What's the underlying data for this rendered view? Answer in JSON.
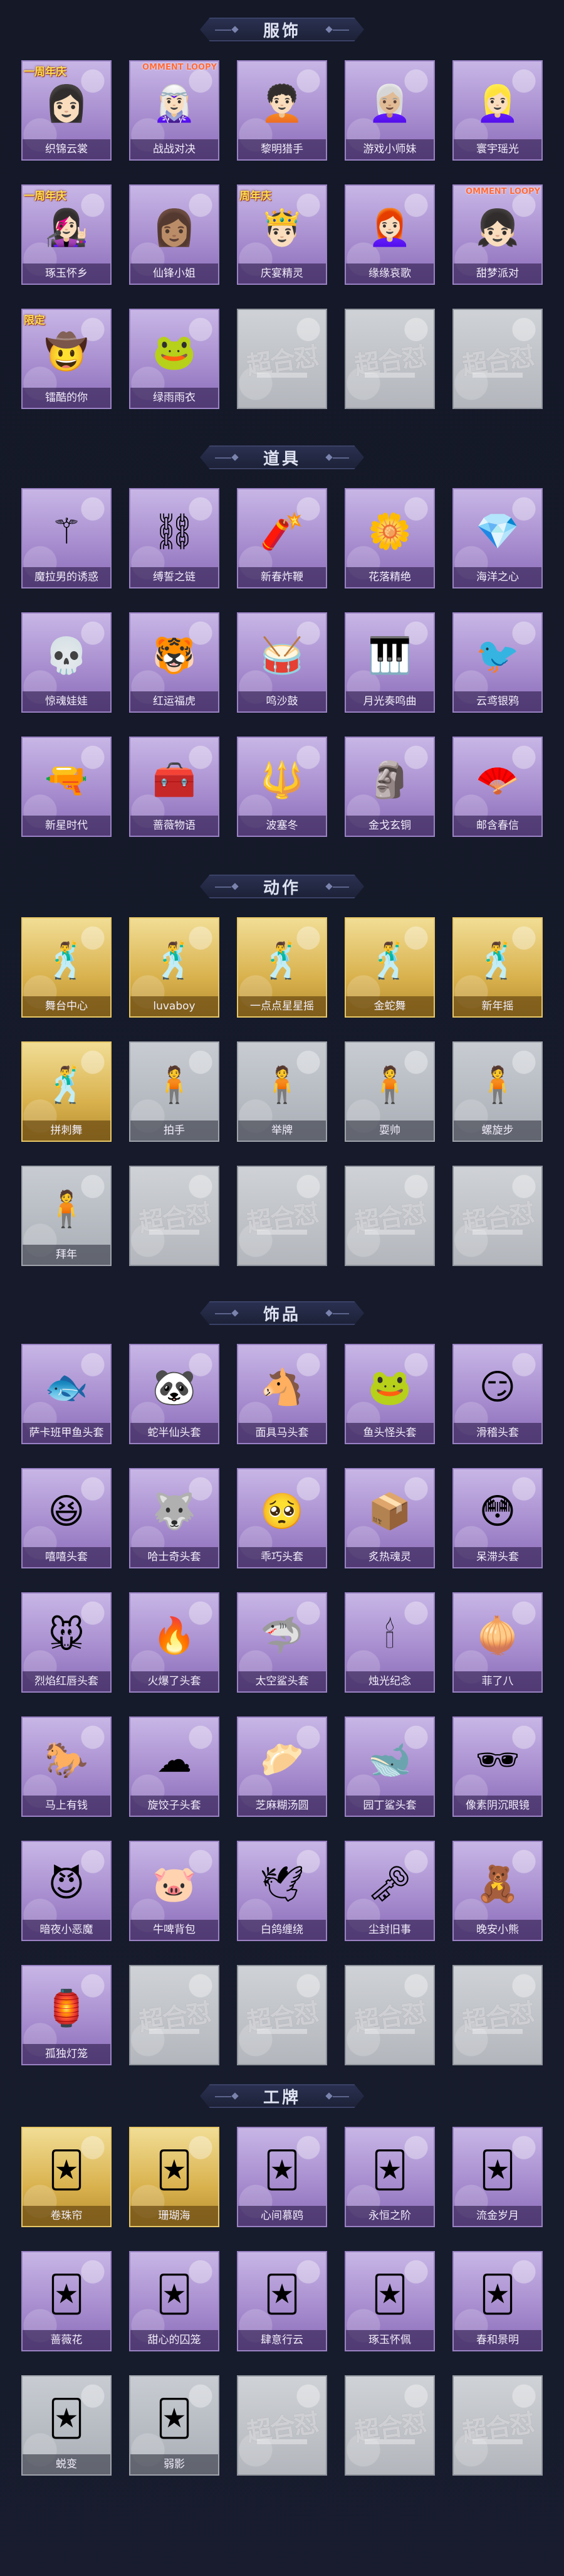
{
  "sections": {
    "clothing": {
      "title": "服饰",
      "items": [
        {
          "label": "织锦云裳",
          "badge": "一周年庆",
          "tone": "purple",
          "icon": "girl-white-hair"
        },
        {
          "label": "战战对决",
          "badge": "OMMENT LOOPY",
          "tone": "purple",
          "icon": "hooded-girl"
        },
        {
          "label": "黎明猎手",
          "badge": "",
          "tone": "purple",
          "icon": "hunter-boy"
        },
        {
          "label": "游戏小师妹",
          "badge": "",
          "tone": "purple",
          "icon": "grey-hair-girl"
        },
        {
          "label": "寰宇瑶光",
          "badge": "",
          "tone": "purple",
          "icon": "silver-hair-girl"
        },
        {
          "label": "琢玉怀乡",
          "badge": "一周年庆",
          "tone": "purple",
          "icon": "purple-hair-girl"
        },
        {
          "label": "仙锋小姐",
          "badge": "",
          "tone": "purple",
          "icon": "brown-hair-lady"
        },
        {
          "label": "庆宴精灵",
          "badge": "周年庆",
          "tone": "purple",
          "icon": "party-boy"
        },
        {
          "label": "缘缘哀歌",
          "badge": "",
          "tone": "purple",
          "icon": "pink-hair-girl"
        },
        {
          "label": "甜梦派对",
          "badge": "OMMENT LOOPY",
          "tone": "purple",
          "icon": "sweet-dream-girl"
        },
        {
          "label": "镭酷的你",
          "badge": "限定",
          "tone": "purple",
          "icon": "hat-girl"
        },
        {
          "label": "绿雨雨衣",
          "badge": "",
          "tone": "purple",
          "icon": "frog-raincoat"
        },
        {
          "label": "",
          "tone": "empty"
        },
        {
          "label": "",
          "tone": "empty"
        },
        {
          "label": "",
          "tone": "empty"
        }
      ]
    },
    "props": {
      "title": "道具",
      "items": [
        {
          "label": "魔拉男的诱惑",
          "tone": "purple",
          "icon": "flower-staff"
        },
        {
          "label": "缚誓之链",
          "tone": "purple",
          "icon": "chain"
        },
        {
          "label": "新春炸鞭",
          "tone": "purple",
          "icon": "firecracker"
        },
        {
          "label": "花落精绝",
          "tone": "purple",
          "icon": "flower-whip"
        },
        {
          "label": "海洋之心",
          "tone": "purple",
          "icon": "pendant"
        },
        {
          "label": "惊魂娃娃",
          "tone": "purple",
          "icon": "skull-doll"
        },
        {
          "label": "红运福虎",
          "tone": "purple",
          "icon": "tiger"
        },
        {
          "label": "鸣沙鼓",
          "tone": "purple",
          "icon": "drum"
        },
        {
          "label": "月光奏鸣曲",
          "tone": "purple",
          "icon": "piano"
        },
        {
          "label": "云鸢银鸦",
          "tone": "purple",
          "icon": "crow"
        },
        {
          "label": "新星时代",
          "tone": "purple",
          "icon": "revolver"
        },
        {
          "label": "蔷薇物语",
          "tone": "purple",
          "icon": "medkit"
        },
        {
          "label": "波塞冬",
          "tone": "purple",
          "icon": "trident"
        },
        {
          "label": "金戈玄铜",
          "tone": "purple",
          "icon": "bronze-idol"
        },
        {
          "label": "邮含春信",
          "tone": "purple",
          "icon": "fan"
        }
      ]
    },
    "actions": {
      "title": "动作",
      "items": [
        {
          "label": "舞台中心",
          "tone": "gold",
          "icon": "dance-pose"
        },
        {
          "label": "luvaboy",
          "tone": "gold",
          "icon": "dance-pose"
        },
        {
          "label": "一点点星星摇",
          "tone": "gold",
          "icon": "dance-pose"
        },
        {
          "label": "金蛇舞",
          "tone": "gold",
          "icon": "dance-pose"
        },
        {
          "label": "新年摇",
          "tone": "gold",
          "icon": "dance-pose"
        },
        {
          "label": "拼刺舞",
          "tone": "gold",
          "icon": "dance-pose"
        },
        {
          "label": "拍手",
          "tone": "grey",
          "icon": "pose"
        },
        {
          "label": "举牌",
          "tone": "grey",
          "icon": "pose"
        },
        {
          "label": "耍帅",
          "tone": "grey",
          "icon": "pose"
        },
        {
          "label": "螺旋步",
          "tone": "grey",
          "icon": "pose"
        },
        {
          "label": "拜年",
          "tone": "grey",
          "icon": "pose"
        },
        {
          "label": "",
          "tone": "empty"
        },
        {
          "label": "",
          "tone": "empty"
        },
        {
          "label": "",
          "tone": "empty"
        },
        {
          "label": "",
          "tone": "empty"
        }
      ]
    },
    "accessories": {
      "title": "饰品",
      "items": [
        {
          "label": "萨卡班甲鱼头套",
          "tone": "purple",
          "icon": "fish-head"
        },
        {
          "label": "蛇半仙头套",
          "tone": "purple",
          "icon": "panda-head"
        },
        {
          "label": "面具马头套",
          "tone": "purple",
          "icon": "horse-head"
        },
        {
          "label": "鱼头怪头套",
          "tone": "purple",
          "icon": "frog-head"
        },
        {
          "label": "滑稽头套",
          "tone": "purple",
          "icon": "funny-face"
        },
        {
          "label": "嘻嘻头套",
          "tone": "purple",
          "icon": "grin"
        },
        {
          "label": "哈士奇头套",
          "tone": "purple",
          "icon": "husky"
        },
        {
          "label": "乖巧头套",
          "tone": "purple",
          "icon": "cute-face"
        },
        {
          "label": "炙热魂灵",
          "tone": "purple",
          "icon": "box-head"
        },
        {
          "label": "呆滞头套",
          "tone": "purple",
          "icon": "dazed-face"
        },
        {
          "label": "烈焰红唇头套",
          "tone": "purple",
          "icon": "pikachu"
        },
        {
          "label": "火爆了头套",
          "tone": "purple",
          "icon": "fire"
        },
        {
          "label": "太空鲨头套",
          "tone": "purple",
          "icon": "shark"
        },
        {
          "label": "烛光纪念",
          "tone": "purple",
          "icon": "candle"
        },
        {
          "label": "菲了八",
          "tone": "purple",
          "icon": "onion"
        },
        {
          "label": "马上有钱",
          "tone": "purple",
          "icon": "pink-horse"
        },
        {
          "label": "旋饺子头套",
          "tone": "purple",
          "icon": "cloud-dog"
        },
        {
          "label": "芝麻糊汤圆",
          "tone": "purple",
          "icon": "dumpling"
        },
        {
          "label": "园丁鲨头套",
          "tone": "purple",
          "icon": "blue-shark"
        },
        {
          "label": "像素阴沉眼镜",
          "tone": "purple",
          "icon": "pixel-glasses"
        },
        {
          "label": "暗夜小恶魔",
          "tone": "purple",
          "icon": "devil"
        },
        {
          "label": "牛啤背包",
          "tone": "purple",
          "icon": "pig-backpack"
        },
        {
          "label": "白鸽缠绕",
          "tone": "purple",
          "icon": "dove"
        },
        {
          "label": "尘封旧事",
          "tone": "purple",
          "icon": "keychain"
        },
        {
          "label": "晚安小熊",
          "tone": "purple",
          "icon": "bear"
        },
        {
          "label": "孤独灯笼",
          "tone": "purple",
          "icon": "lantern"
        },
        {
          "label": "",
          "tone": "empty"
        },
        {
          "label": "",
          "tone": "empty"
        },
        {
          "label": "",
          "tone": "empty"
        },
        {
          "label": "",
          "tone": "empty"
        }
      ]
    },
    "badges": {
      "title": "工牌",
      "items": [
        {
          "label": "卷珠帘",
          "tone": "gold",
          "icon": "card-frame"
        },
        {
          "label": "珊瑚海",
          "tone": "gold",
          "icon": "card-frame"
        },
        {
          "label": "心间慕鸥",
          "tone": "purple",
          "icon": "card-frame"
        },
        {
          "label": "永恒之阶",
          "tone": "purple",
          "icon": "card-frame"
        },
        {
          "label": "流金岁月",
          "tone": "purple",
          "icon": "card-frame"
        },
        {
          "label": "蔷薇花",
          "tone": "purple",
          "icon": "card-frame"
        },
        {
          "label": "甜心的囚笼",
          "tone": "purple",
          "icon": "card-frame"
        },
        {
          "label": "肆意行云",
          "tone": "purple",
          "icon": "card-frame"
        },
        {
          "label": "琢玉怀佩",
          "tone": "purple",
          "icon": "card-frame"
        },
        {
          "label": "春和景明",
          "tone": "purple",
          "icon": "card-frame"
        },
        {
          "label": "蜕变",
          "tone": "grey",
          "icon": "card-frame"
        },
        {
          "label": "弱影",
          "tone": "grey",
          "icon": "card-frame"
        },
        {
          "label": "",
          "tone": "empty"
        },
        {
          "label": "",
          "tone": "empty"
        },
        {
          "label": "",
          "tone": "empty"
        }
      ]
    }
  },
  "watermark_text": "超合怼",
  "colors": {
    "background": "#141827",
    "purple_card": "#a58acd",
    "gold_card": "#d9b24e",
    "grey_card": "#a9aeb6"
  }
}
